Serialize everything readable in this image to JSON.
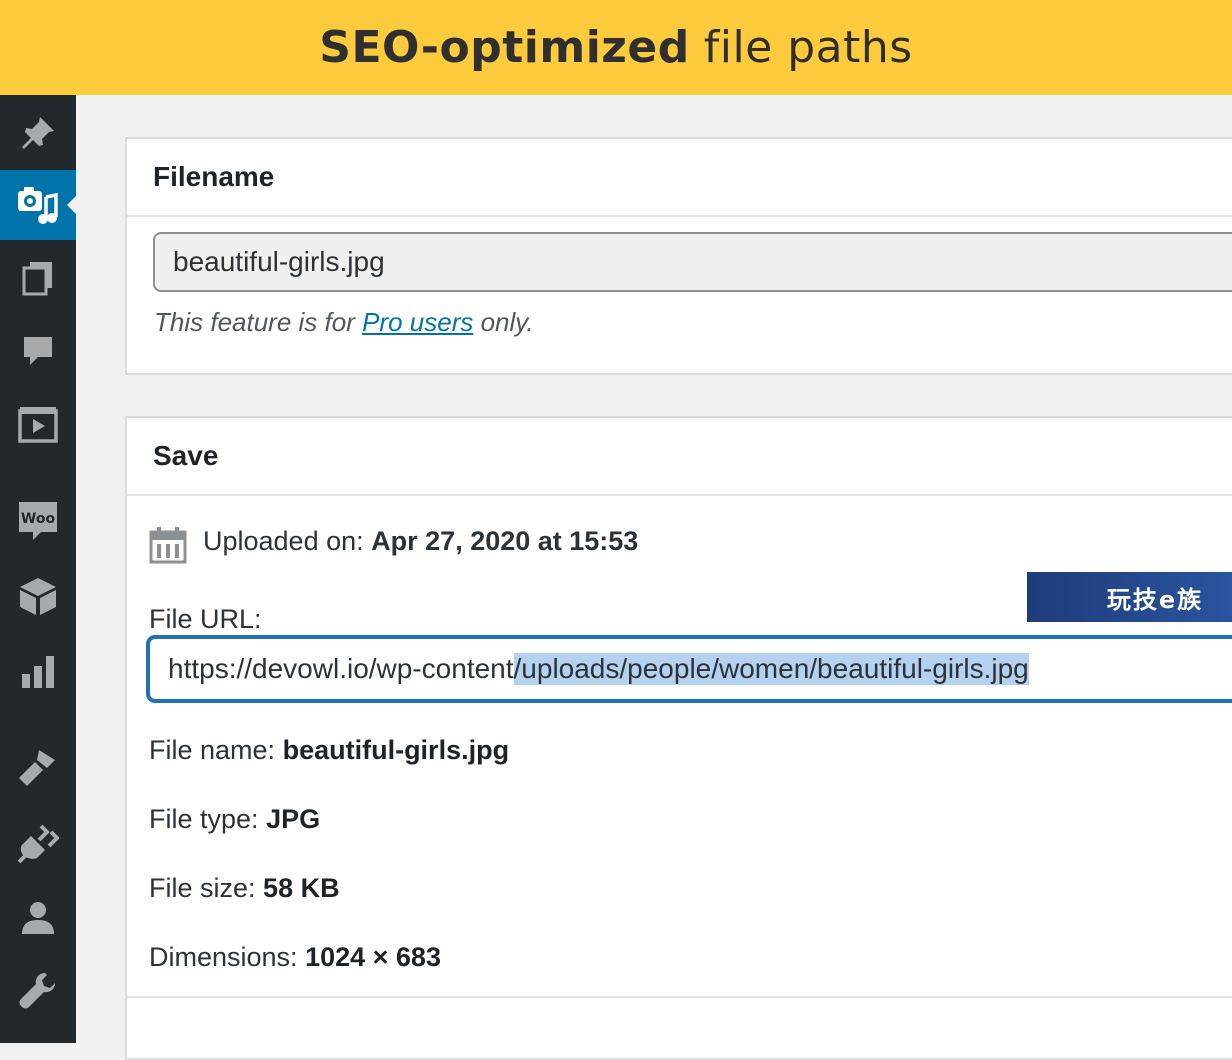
{
  "banner": {
    "title_bold": "SEO-optimized",
    "title_rest": "file paths"
  },
  "sidebar": {
    "items": [
      {
        "icon": "pin-icon"
      },
      {
        "icon": "media-icon",
        "active": true
      },
      {
        "icon": "pages-icon"
      },
      {
        "icon": "comments-icon"
      },
      {
        "icon": "video-icon"
      },
      {
        "icon": "woocommerce-icon",
        "label": "Woo"
      },
      {
        "icon": "products-icon"
      },
      {
        "icon": "analytics-icon"
      },
      {
        "icon": "appearance-icon"
      },
      {
        "icon": "plugins-icon"
      },
      {
        "icon": "users-icon"
      },
      {
        "icon": "tools-icon"
      }
    ]
  },
  "filename_panel": {
    "heading": "Filename",
    "value": "beautiful-girls.jpg",
    "note_before": "This feature is for",
    "note_link": "Pro users",
    "note_after": "only."
  },
  "save_panel": {
    "heading": "Save",
    "uploaded_label": "Uploaded on:",
    "uploaded_value": "Apr 27, 2020 at 15:53",
    "file_url_label": "File URL:",
    "file_url_plain": "https://devowl.io/wp-content",
    "file_url_selected": "/uploads/people/women/beautiful-girls.jpg",
    "file_name_label": "File name:",
    "file_name_value": "beautiful-girls.jpg",
    "file_type_label": "File type:",
    "file_type_value": "JPG",
    "file_size_label": "File size:",
    "file_size_value": "58 KB",
    "dimensions_label": "Dimensions:",
    "dimensions_value": "1024 × 683"
  },
  "watermark": "玩技e族"
}
